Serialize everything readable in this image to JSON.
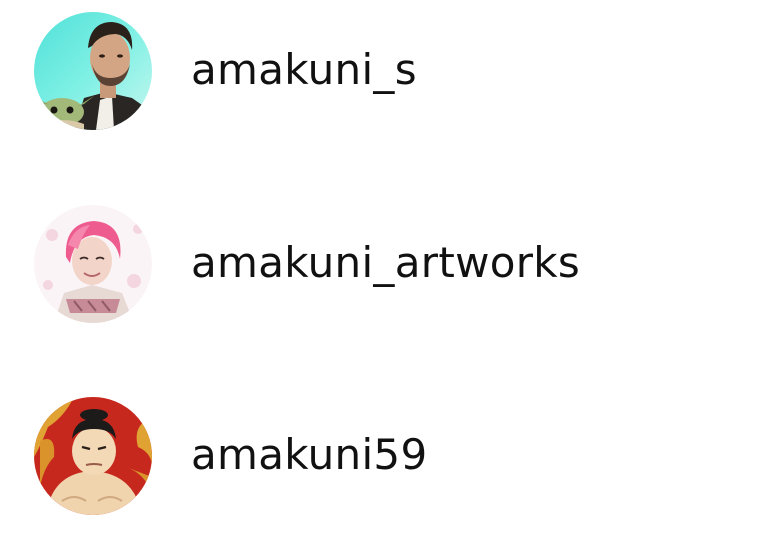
{
  "accounts": [
    {
      "username": "amakuni_s",
      "avatar_icon": "portrait-man-with-baby-yoda-avatar"
    },
    {
      "username": "amakuni_artworks",
      "avatar_icon": "portrait-pink-hair-person-avatar"
    },
    {
      "username": "amakuni59",
      "avatar_icon": "portrait-sumo-wrestler-avatar"
    }
  ],
  "colors": {
    "text": "#111111",
    "background": "#ffffff"
  }
}
